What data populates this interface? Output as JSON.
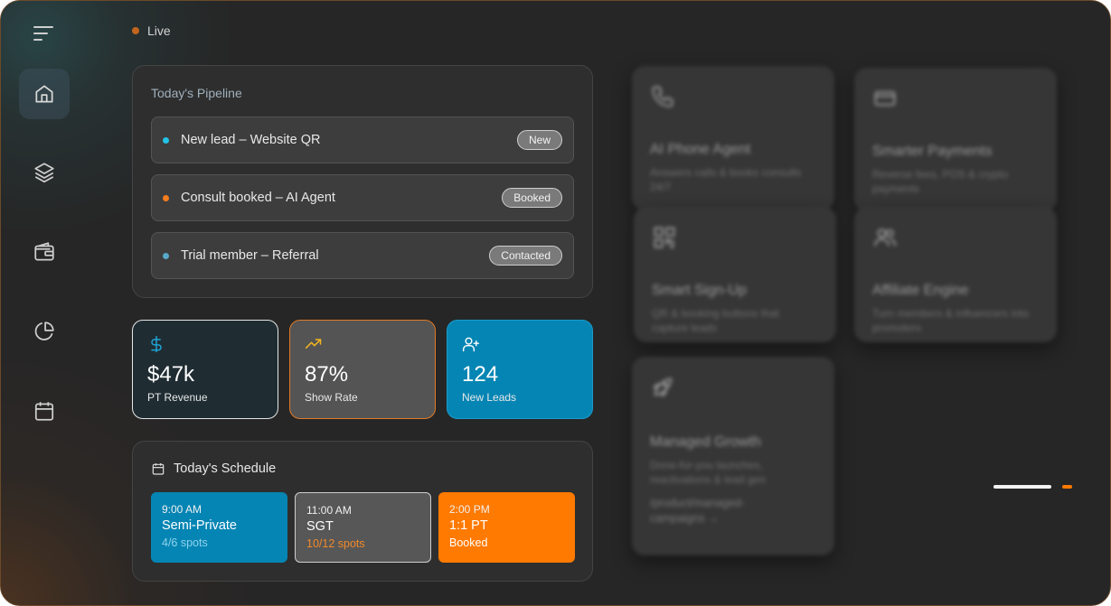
{
  "status": {
    "live_label": "Live"
  },
  "sidebar": {
    "items": [
      {
        "name": "home",
        "icon": "home-icon",
        "active": true
      },
      {
        "name": "layers",
        "icon": "layers-icon",
        "active": false
      },
      {
        "name": "wallet",
        "icon": "wallet-icon",
        "active": false
      },
      {
        "name": "reports",
        "icon": "pie-chart-icon",
        "active": false
      },
      {
        "name": "calendar",
        "icon": "calendar-icon",
        "active": false
      }
    ]
  },
  "pipeline": {
    "title": "Today's Pipeline",
    "leads": [
      {
        "label": "New lead – Website QR",
        "status": "New",
        "dot_color": "#22c3e6"
      },
      {
        "label": "Consult booked – AI Agent",
        "status": "Booked",
        "dot_color": "#f57c1f"
      },
      {
        "label": "Trial member – Referral",
        "status": "Contacted",
        "dot_color": "#5aa8c9"
      }
    ]
  },
  "stats": [
    {
      "value": "$47k",
      "label": "PT Revenue",
      "icon": "dollar-icon"
    },
    {
      "value": "87%",
      "label": "Show Rate",
      "icon": "trending-up-icon"
    },
    {
      "value": "124",
      "label": "New Leads",
      "icon": "user-plus-icon"
    }
  ],
  "schedule": {
    "title": "Today's Schedule",
    "slots": [
      {
        "time": "9:00 AM",
        "name": "Semi-Private",
        "detail": "4/6 spots"
      },
      {
        "time": "11:00 AM",
        "name": "SGT",
        "detail": "10/12 spots"
      },
      {
        "time": "2:00 PM",
        "name": "1:1 PT",
        "detail": "Booked"
      }
    ]
  },
  "products": [
    {
      "title": "AI Phone Agent",
      "desc": "Answers calls & books consults 24/7",
      "icon": "phone-icon"
    },
    {
      "title": "Smarter Payments",
      "desc": "Reverse fees, POS & crypto payments",
      "icon": "credit-card-icon"
    },
    {
      "title": "Smart Sign-Up",
      "desc": "QR & booking buttons that capture leads",
      "icon": "qr-code-icon"
    },
    {
      "title": "Affiliate Engine",
      "desc": "Turn members & influencers into promoters",
      "icon": "users-icon"
    },
    {
      "title": "Managed Growth",
      "desc": "Done-for-you launches, reactivations & lead gen",
      "link": "/product/managed-campaigns →",
      "icon": "rocket-icon"
    }
  ],
  "colors": {
    "accent_orange": "#ff7a00",
    "accent_blue": "#0088b8",
    "card_bg": "#2e2e2e"
  }
}
